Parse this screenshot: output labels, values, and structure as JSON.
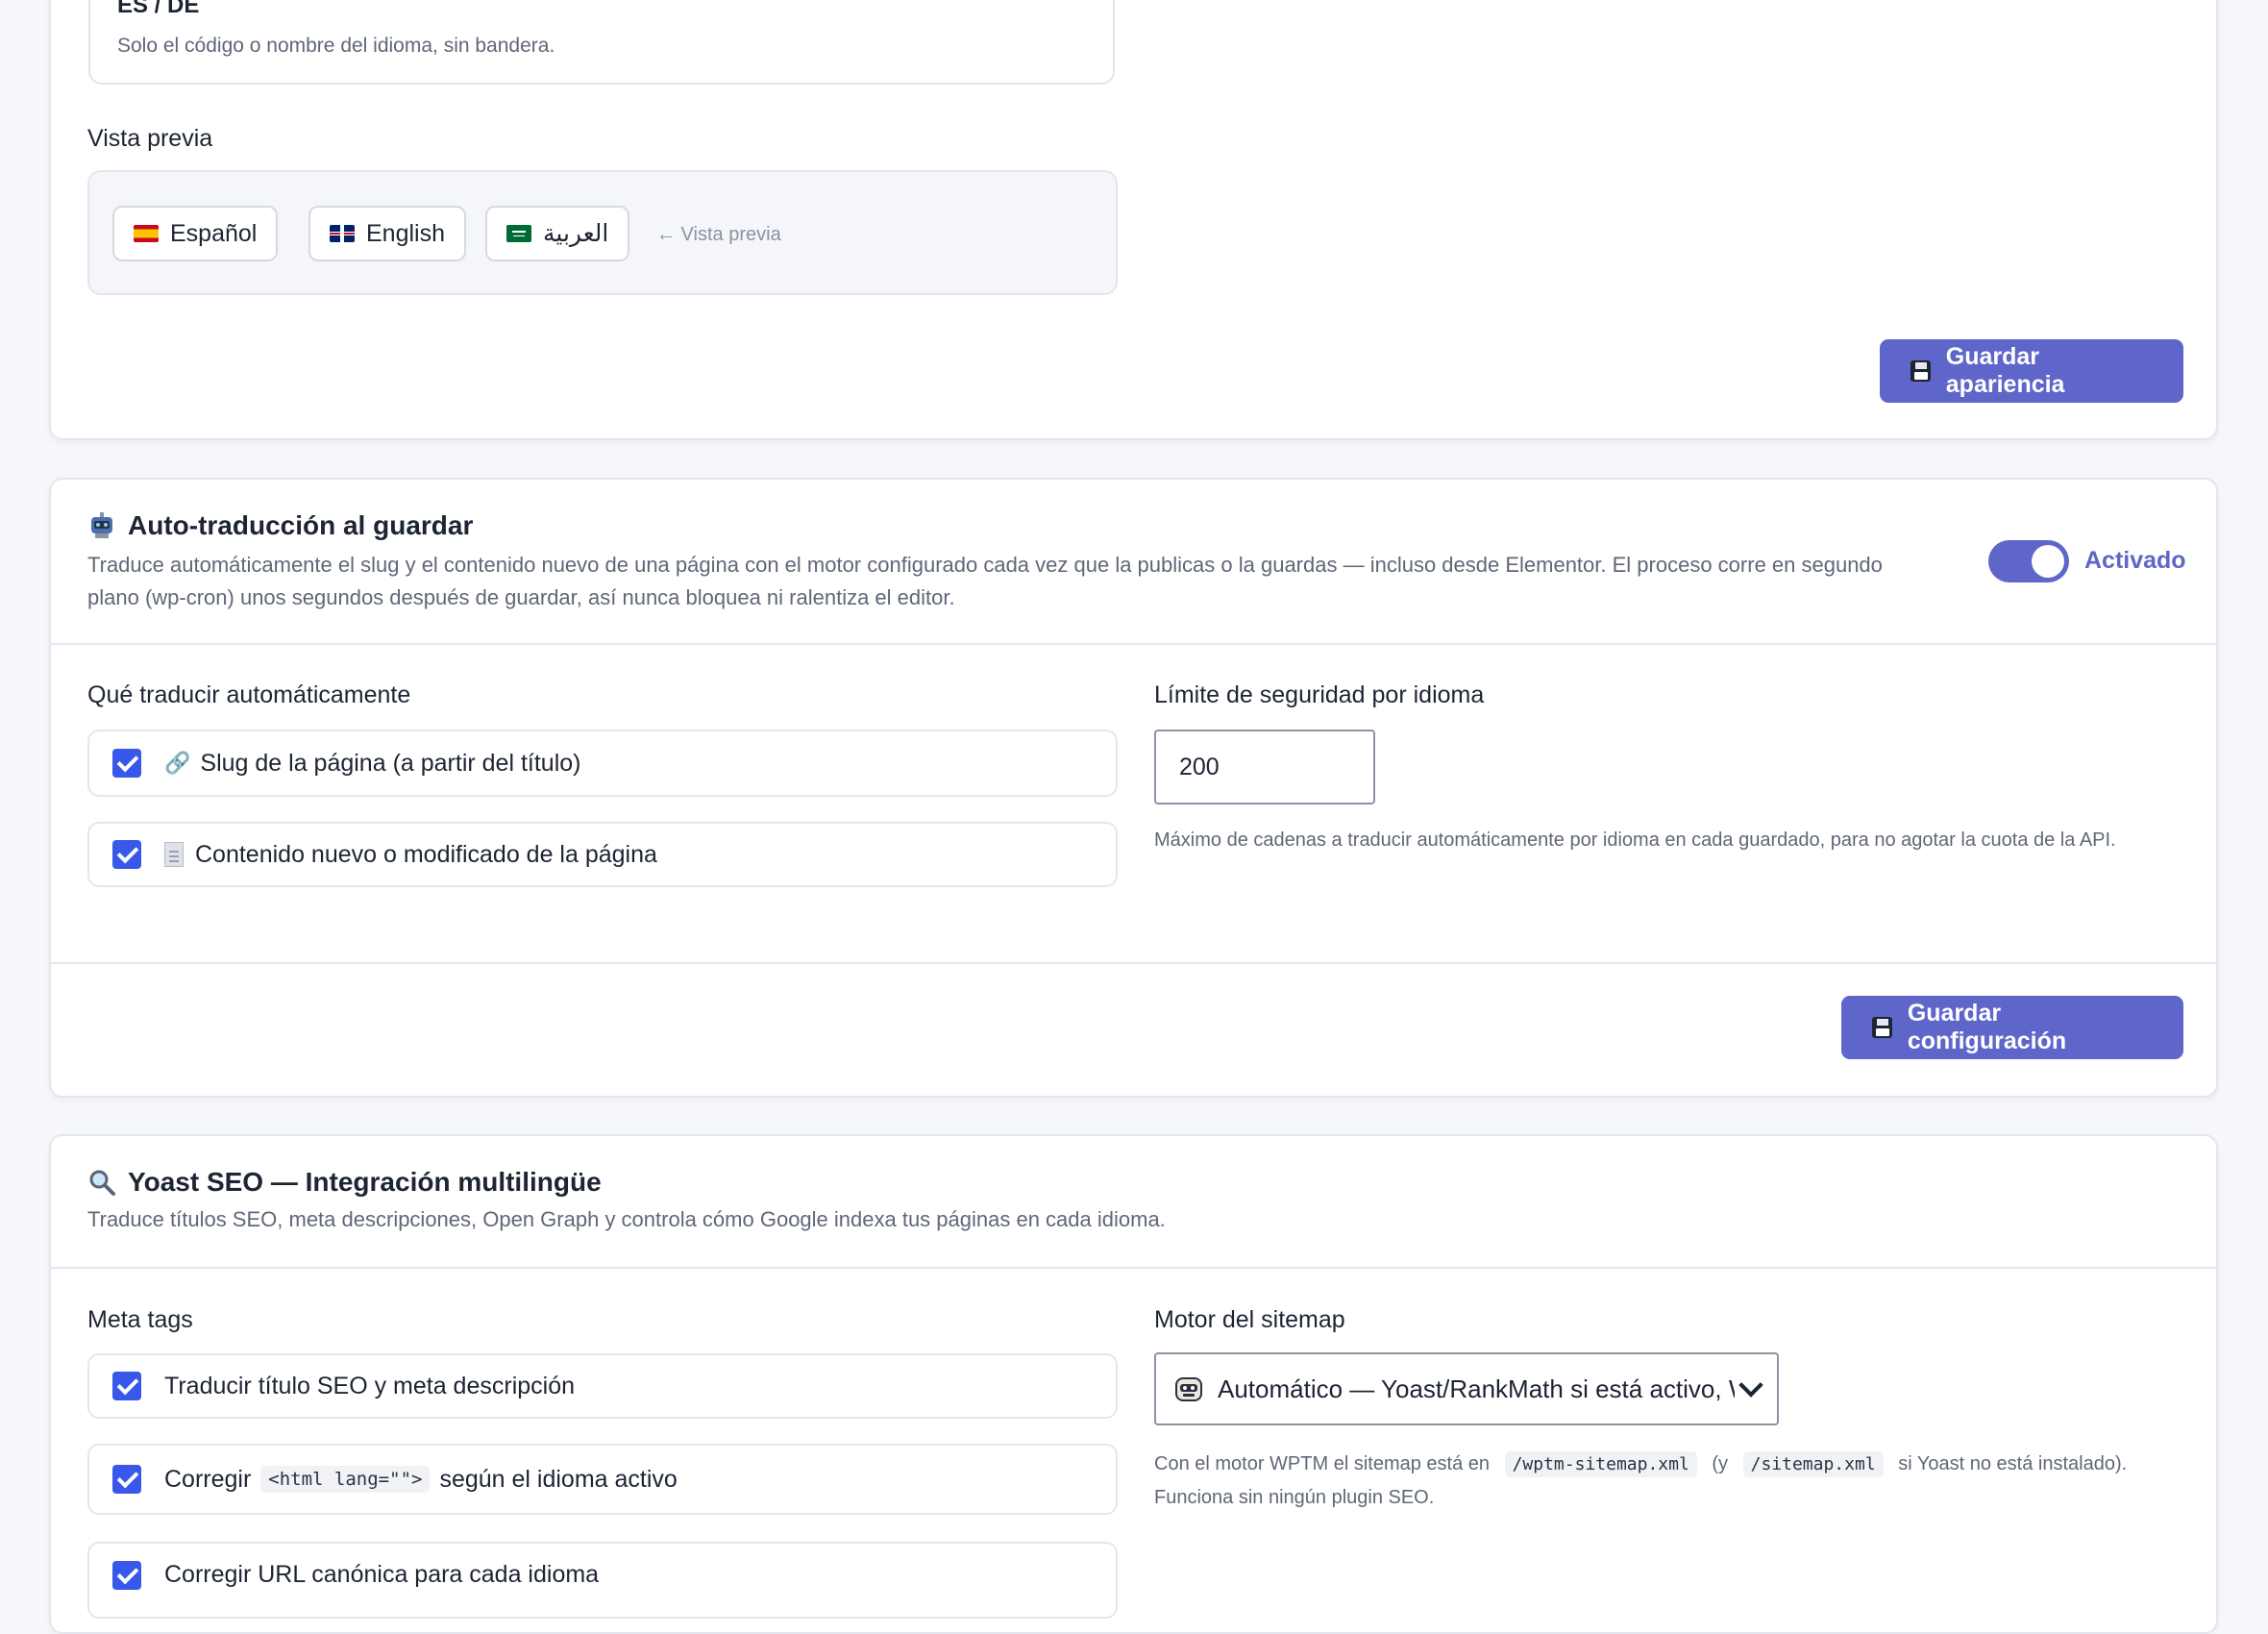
{
  "appearance": {
    "code_title": "ES / DE",
    "code_hint": "Solo el código o nombre del idioma, sin bandera.",
    "preview_label": "Vista previa",
    "preview_langs": [
      {
        "name": "Español",
        "flag": "flag-es"
      },
      {
        "name": "English",
        "flag": "flag-gb"
      },
      {
        "name": "العربية",
        "flag": "flag-sa"
      }
    ],
    "preview_note": "← Vista previa",
    "save_label": "Guardar apariencia"
  },
  "autotranslate": {
    "title": "Auto-traducción al guardar",
    "title_icon": "robot-icon",
    "description_line1": "Traduce automáticamente el slug y el contenido nuevo de una página con el motor configurado cada vez que la publicas o la guardas — incluso desde Elementor. El proceso corre en segundo",
    "description_line2": "plano (wp-cron) unos segundos después de guardar, así nunca bloquea ni ralentiza el editor.",
    "toggle_label": "Activado",
    "toggle_on": true,
    "what_label": "Qué traducir automáticamente",
    "options": [
      {
        "label": "Slug de la página (a partir del título)",
        "icon": "link-icon",
        "checked": true
      },
      {
        "label": "Contenido nuevo o modificado de la página",
        "icon": "document-icon",
        "checked": true
      }
    ],
    "limit_label": "Límite de seguridad por idioma",
    "limit_value": "200",
    "limit_help": "Máximo de cadenas a traducir automáticamente por idioma en cada guardado, para no agotar la cuota de la API.",
    "save_label": "Guardar configuración"
  },
  "yoast": {
    "title": "Yoast SEO — Integración multilingüe",
    "title_icon": "magnifier-icon",
    "description": "Traduce títulos SEO, meta descripciones, Open Graph y controla cómo Google indexa tus páginas en cada idioma.",
    "meta_label": "Meta tags",
    "meta_options": [
      {
        "label": "Traducir título SEO y meta descripción",
        "checked": true
      },
      {
        "label_before": "Corregir",
        "code": "<html lang=\"\">",
        "label_after": "según el idioma activo",
        "checked": true
      },
      {
        "label": "Corregir URL canónica para cada idioma",
        "checked": true
      }
    ],
    "sitemap_label": "Motor del sitemap",
    "sitemap_value": "Automático — Yoast/RankMath si está activo, WPTM si no",
    "sitemap_help_1": "Con el motor WPTM el sitemap está en",
    "sitemap_code_1": "/wptm-sitemap.xml",
    "sitemap_help_2": "(y",
    "sitemap_code_2": "/sitemap.xml",
    "sitemap_help_3": "si Yoast no está instalado).",
    "sitemap_help_line2": "Funciona sin ningún plugin SEO."
  },
  "colors": {
    "accent": "#5e66c9",
    "checkbox": "#3858e9",
    "background": "#f6f7fb"
  }
}
